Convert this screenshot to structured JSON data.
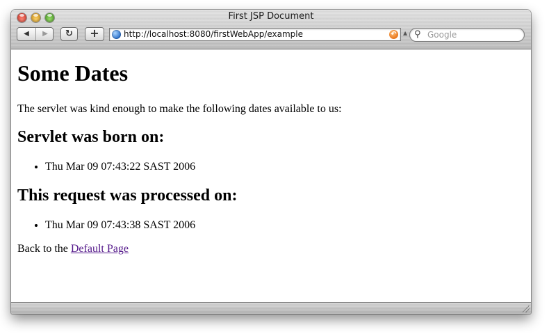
{
  "window": {
    "title": "First JSP Document"
  },
  "toolbar": {
    "back_label": "◀",
    "forward_label": "▶",
    "reload_label": "↻",
    "add_bookmark_label": "+",
    "url": "http://localhost:8080/firstWebApp/example",
    "search_placeholder": "Google"
  },
  "icons": {
    "globe": "globe-icon",
    "snapback": "snapback-icon",
    "search": "search-icon",
    "resize": "resize-grip-icon"
  },
  "page": {
    "heading": "Some Dates",
    "intro": "The servlet was kind enough to make the following dates available to us:",
    "born_heading": "Servlet was born on:",
    "born_date": "Thu Mar 09 07:43:22 SAST 2006",
    "processed_heading": "This request was processed on:",
    "processed_date": "Thu Mar 09 07:43:38 SAST 2006",
    "back_prefix": "Back to the ",
    "back_link": "Default Page"
  },
  "colors": {
    "link_visited": "#551a8b",
    "close_button": "#e0443a",
    "minimize_button": "#f2b43a",
    "zoom_button": "#6cc04a"
  }
}
